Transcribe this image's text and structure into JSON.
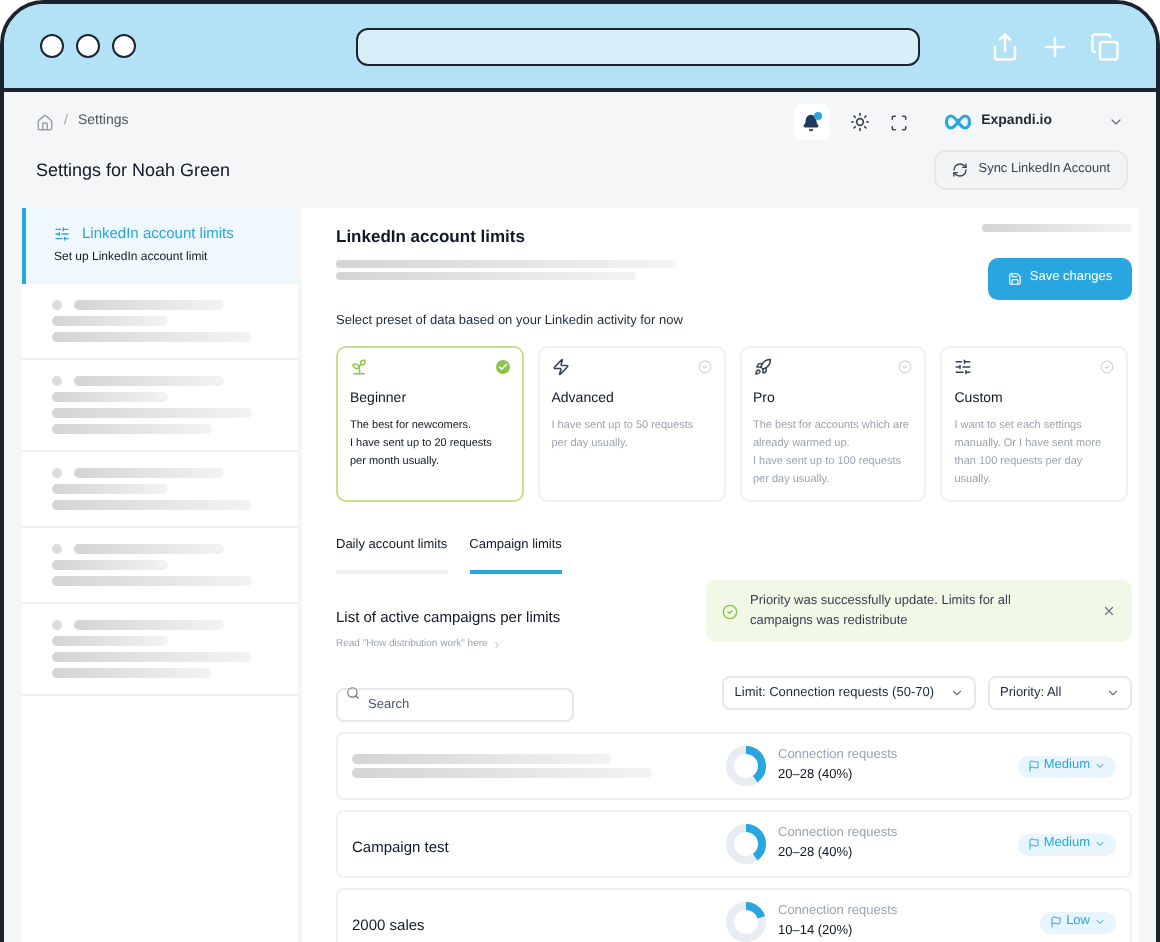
{
  "breadcrumb": {
    "separator": "/",
    "items": [
      "Settings"
    ]
  },
  "header": {
    "title": "Settings for Noah Green",
    "account": "Expandi.io",
    "sync_button": "Sync LinkedIn Account"
  },
  "sidebar": {
    "items": [
      {
        "title": "LinkedIn account limits",
        "subtitle": "Set up LinkedIn account limit",
        "selected": true
      }
    ]
  },
  "panel": {
    "title": "LinkedIn account limits",
    "save_button": "Save changes",
    "preset_prompt": "Select preset of data based on your Linkedin activity for now",
    "presets": [
      {
        "title": "Beginner",
        "description": "The best for newcomers.\nI have sent up to 20 requests per month usually.",
        "selected": true
      },
      {
        "title": "Advanced",
        "description": "I have sent up to 50 requests per day usually.",
        "selected": false
      },
      {
        "title": "Pro",
        "description": "The best for accounts which are already warmed up.\nI have sent up to 100 requests per day usually.",
        "selected": false
      },
      {
        "title": "Custom",
        "description": "I want to set each settings manually. Or I have sent more than 100 requests per day usually.",
        "selected": false
      }
    ],
    "tabs": [
      {
        "label": "Daily account limits",
        "selected": false
      },
      {
        "label": "Campaign limits",
        "selected": true
      }
    ],
    "list_title": "List of active campaigns per limits",
    "list_link": "Read \"How distribution work\" here",
    "toast": {
      "message": "Priority was successfully update. Limits for all campaigns was redistribute"
    },
    "search": {
      "placeholder": "Search"
    },
    "filters": [
      "Limit: Connection requests (50-70)",
      "Priority: All"
    ],
    "campaigns": [
      {
        "metric": "Connection requests",
        "range": "20–28 (40%)",
        "level": 0.4,
        "priority": "Medium"
      },
      {
        "name": "Campaign test",
        "metric": "Connection requests",
        "range": "20–28 (40%)",
        "level": 0.4,
        "priority": "Medium"
      },
      {
        "name": "2000 sales",
        "metric": "Connection requests",
        "range": "10–14 (20%)",
        "level": 0.2,
        "priority": "Low"
      }
    ]
  }
}
